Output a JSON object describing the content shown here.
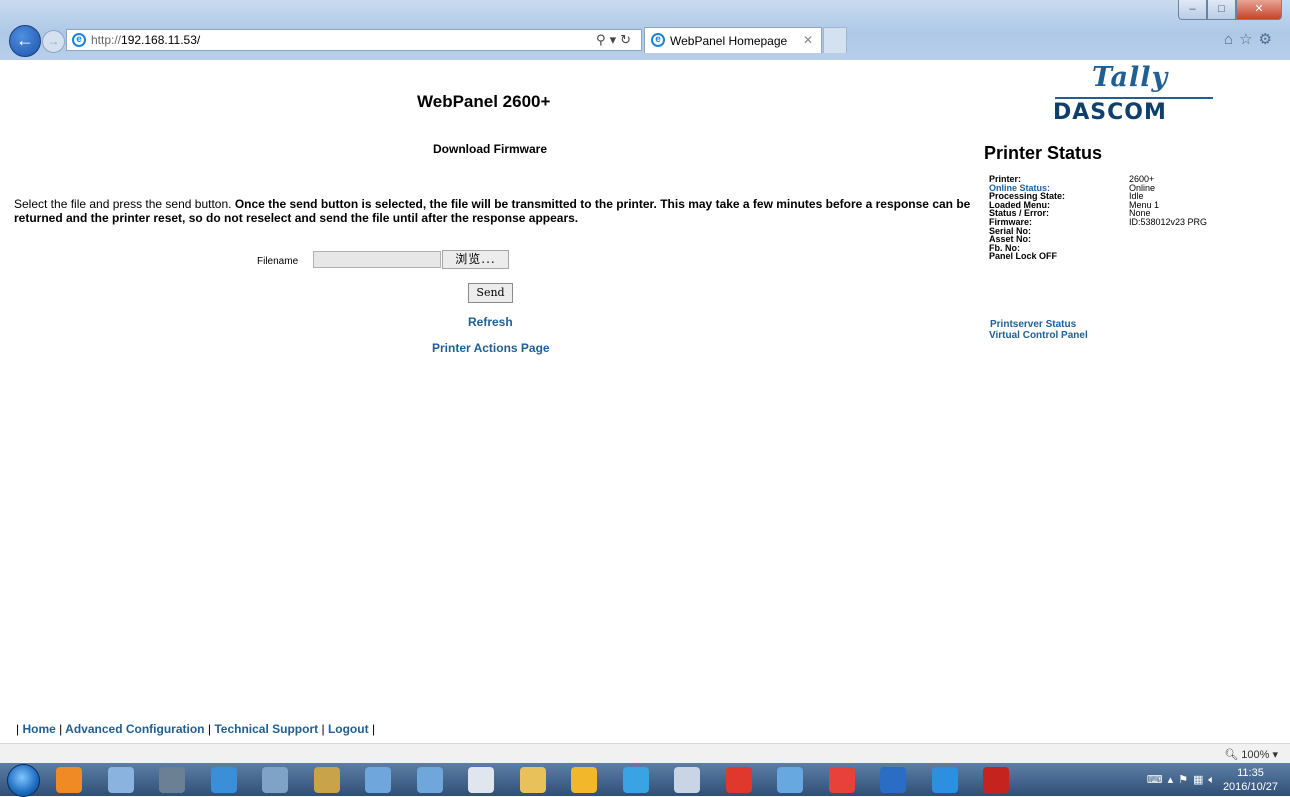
{
  "browser": {
    "url_prefix": "http://",
    "url_host": "192.168.11.53/",
    "tab_title": "WebPanel Homepage",
    "zoom_level": "100%"
  },
  "page": {
    "title": "WebPanel 2600+",
    "section_title": "Download Firmware",
    "instructions_plain": "Select the file and press the send button. ",
    "instructions_bold": "Once the send button is selected, the file will be transmitted to the printer. This may take a few minutes before a response can be returned and the printer reset, so do not reselect and send the file until after the response appears.",
    "filename_label": "Filename",
    "browse_label": "浏览...",
    "send_label": "Send",
    "refresh_link": "Refresh",
    "actions_link": "Printer Actions Page"
  },
  "logo": {
    "line1": "Tally",
    "line2": "DASCOM"
  },
  "status": {
    "heading": "Printer Status",
    "rows": [
      {
        "key": "Printer:",
        "value": "2600+"
      },
      {
        "key": "Online Status:",
        "value": "Online"
      },
      {
        "key": "Processing State:",
        "value": "Idle"
      },
      {
        "key": "Loaded Menu:",
        "value": "Menu 1"
      },
      {
        "key": "Status / Error:",
        "value": "None"
      },
      {
        "key": "Firmware:",
        "value": "ID:538012v23 PRG"
      },
      {
        "key": "Serial No:",
        "value": ""
      },
      {
        "key": "Asset No:",
        "value": ""
      },
      {
        "key": "Fb. No:",
        "value": ""
      },
      {
        "key": "Panel Lock OFF",
        "value": ""
      }
    ],
    "printserver_link": "Printserver Status",
    "virtual_panel_link": "Virtual Control Panel"
  },
  "footer": {
    "sep": "|",
    "home": "Home",
    "advanced": "Advanced Configuration",
    "support": "Technical Support",
    "logout": "Logout"
  },
  "taskbar": {
    "time": "11:35",
    "date": "2016/10/27",
    "apps": [
      {
        "icon": "browser-fox-icon",
        "color": "#f08a24"
      },
      {
        "icon": "grid-app-icon",
        "color": "#8ab4df"
      },
      {
        "icon": "building-icon",
        "color": "#6b7f95"
      },
      {
        "icon": "network-icon",
        "color": "#3a8fd8"
      },
      {
        "icon": "calculator-icon",
        "color": "#7ea3c7"
      },
      {
        "icon": "fc-app-icon",
        "color": "#c8a34a"
      },
      {
        "icon": "settings-gear-icon",
        "color": "#6fa6db"
      },
      {
        "icon": "settings-gear-2-icon",
        "color": "#6fa6db"
      },
      {
        "icon": "printer-app-icon",
        "color": "#dfe6ee"
      },
      {
        "icon": "file-explorer-icon",
        "color": "#e8c15a"
      },
      {
        "icon": "penguin-icon",
        "color": "#f2b72a"
      },
      {
        "icon": "outlook-icon",
        "color": "#3aa3e3"
      },
      {
        "icon": "tools-icon",
        "color": "#c7d5e4"
      },
      {
        "icon": "red-app-icon",
        "color": "#e0382d"
      },
      {
        "icon": "paint-icon",
        "color": "#66a8df"
      },
      {
        "icon": "heart-app-icon",
        "color": "#e8413a"
      },
      {
        "icon": "word-icon",
        "color": "#2b6cc4"
      },
      {
        "icon": "internet-explorer-icon",
        "color": "#2d8fe0"
      },
      {
        "icon": "pdf-reader-icon",
        "color": "#c4231e"
      }
    ]
  }
}
